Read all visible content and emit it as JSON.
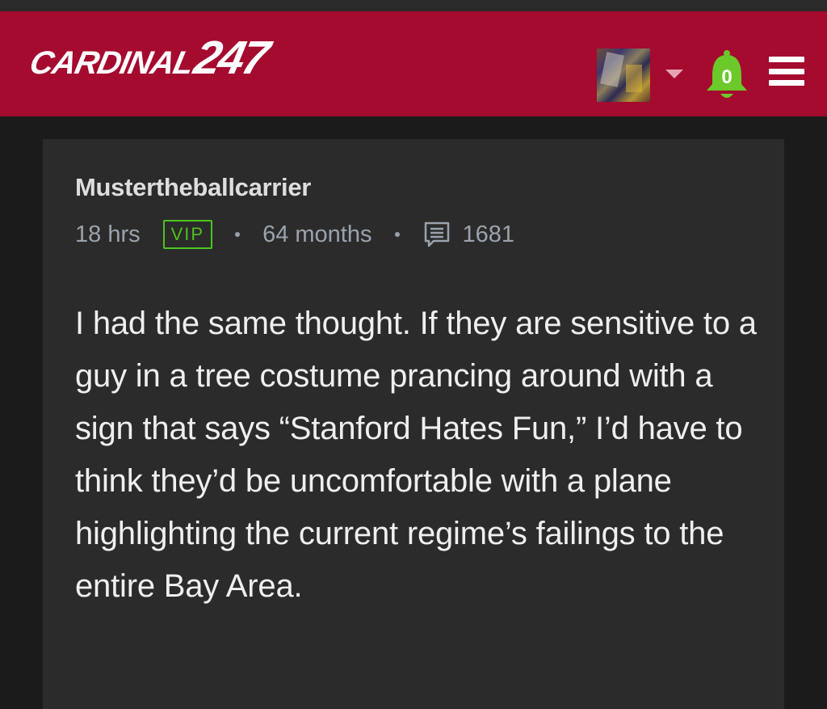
{
  "header": {
    "logo_word": "CARDINAL",
    "logo_number": "247",
    "notification_count": "0",
    "brand_color": "#a50a2f"
  },
  "post": {
    "username": "Mustertheballcarrier",
    "time_ago": "18 hrs",
    "badge": "VIP",
    "membership": "64 months",
    "post_count": "1681",
    "body": "I had the same thought. If they are sensitive to a guy in a tree costume prancing around with a sign that says “Stanford Hates Fun,” I’d have to think they’d be uncomfortable with a plane highlighting the current regime’s failings to the entire Bay Area."
  },
  "icons": {
    "avatar": "user-avatar",
    "caret": "chevron-down-icon",
    "bell": "bell-icon",
    "menu": "hamburger-menu-icon",
    "posts": "message-icon"
  },
  "colors": {
    "vip": "#4ec21f",
    "bell": "#6bc92a"
  }
}
